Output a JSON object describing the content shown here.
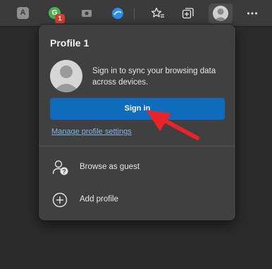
{
  "toolbar": {
    "extension_a_letter": "A",
    "extension_g_letter": "G",
    "extension_badge_count": "1",
    "icons": [
      "extension-a-icon",
      "extension-grammar-icon",
      "extension-screen-icon",
      "extension-edge-icon",
      "favorites-icon",
      "collections-icon",
      "profile-avatar-icon",
      "more-menu-icon"
    ]
  },
  "panel": {
    "title": "Profile 1",
    "sync_text": "Sign in to sync your browsing data across devices.",
    "signin_label": "Sign in",
    "manage_link": "Manage profile settings",
    "menu": [
      {
        "label": "Browse as guest",
        "icon": "guest-icon"
      },
      {
        "label": "Add profile",
        "icon": "add-icon"
      }
    ]
  },
  "colors": {
    "background": "#2b2b2b",
    "toolbar": "#3b3b3b",
    "panel": "#404040",
    "signin_button": "#0f6cbd",
    "link": "#7fb6e8",
    "annotation_arrow": "#e8232a"
  },
  "annotation": {
    "type": "arrow",
    "points_to": "signin-button"
  }
}
